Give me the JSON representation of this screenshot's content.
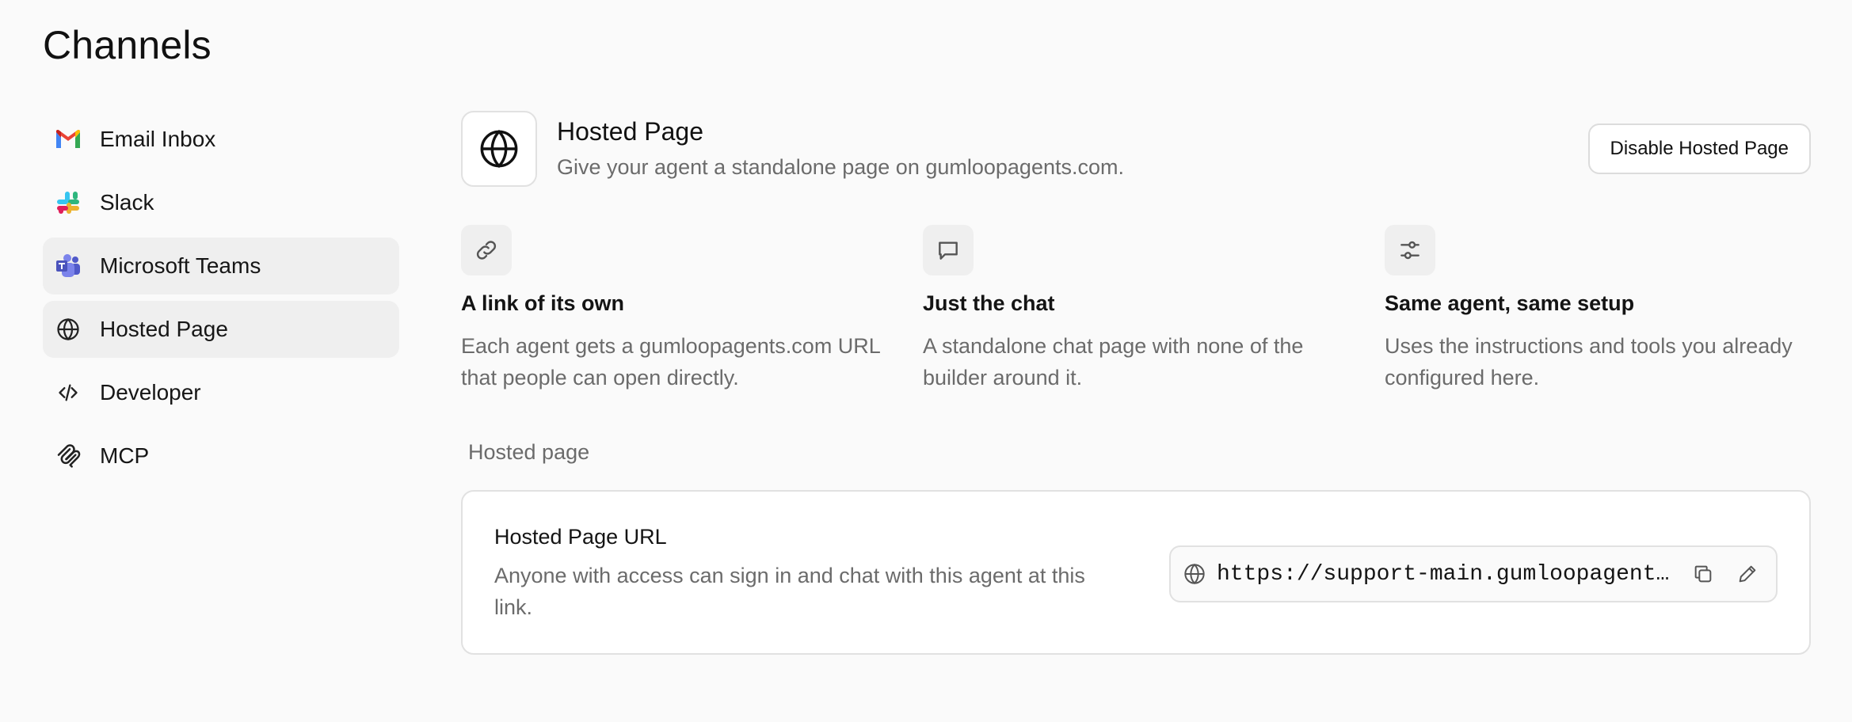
{
  "page": {
    "title": "Channels"
  },
  "sidebar": {
    "items": [
      {
        "label": "Email Inbox",
        "icon": "gmail-icon",
        "active": false
      },
      {
        "label": "Slack",
        "icon": "slack-icon",
        "active": false
      },
      {
        "label": "Microsoft Teams",
        "icon": "teams-icon",
        "active": true
      },
      {
        "label": "Hosted Page",
        "icon": "globe-icon",
        "active": true
      },
      {
        "label": "Developer",
        "icon": "code-icon",
        "active": false
      },
      {
        "label": "MCP",
        "icon": "mcp-icon",
        "active": false
      }
    ]
  },
  "main": {
    "header": {
      "title": "Hosted Page",
      "description": "Give your agent a standalone page on gumloopagents.com.",
      "disable_button": "Disable Hosted Page",
      "icon": "globe-icon"
    },
    "features": [
      {
        "icon": "link-icon",
        "title": "A link of its own",
        "description": "Each agent gets a gumloopagents.com URL that people can open directly."
      },
      {
        "icon": "chat-bubble-icon",
        "title": "Just the chat",
        "description": "A standalone chat page with none of the builder around it."
      },
      {
        "icon": "sliders-icon",
        "title": "Same agent, same setup",
        "description": "Uses the instructions and tools you already configured here."
      }
    ],
    "section_label": "Hosted page",
    "url_card": {
      "title": "Hosted Page URL",
      "description": "Anyone with access can sign in and chat with this agent at this link.",
      "url": "https://support-main.gumloopagents.com",
      "copy_icon": "copy-icon",
      "edit_icon": "pencil-icon"
    }
  },
  "colors": {
    "background": "#fafafa",
    "card_border": "#e1e1e1",
    "muted_text": "#6b6b6b",
    "active_nav": "#efefef"
  }
}
